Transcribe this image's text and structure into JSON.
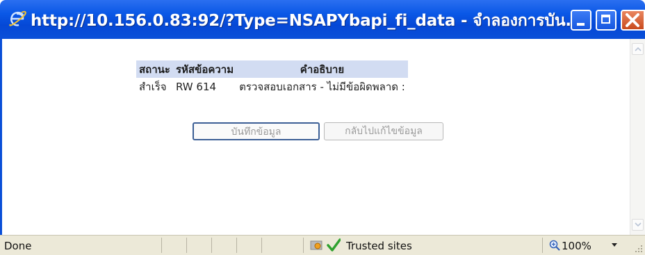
{
  "window": {
    "title": "http://10.156.0.83:92/?Type=NSAPYbapi_fi_data - จำลองการบัน..."
  },
  "message_table": {
    "headers": [
      "สถานะ",
      "รหัสข้อความ",
      "คำอธิบาย"
    ],
    "rows": [
      [
        "สำเร็จ",
        "RW 614",
        "ตรวจสอบเอกสาร - ไม่มีข้อผิดพลาด :"
      ]
    ]
  },
  "buttons": {
    "save": "บันทึกข้อมูล",
    "back": "กลับไปแก้ไขข้อมูล"
  },
  "statusbar": {
    "status": "Done",
    "zone": "Trusted sites",
    "zoom": "100%"
  },
  "colors": {
    "titlebar": "#0a4fd8",
    "table_header": "#d2dcf2",
    "close_button": "#d35a2b"
  }
}
